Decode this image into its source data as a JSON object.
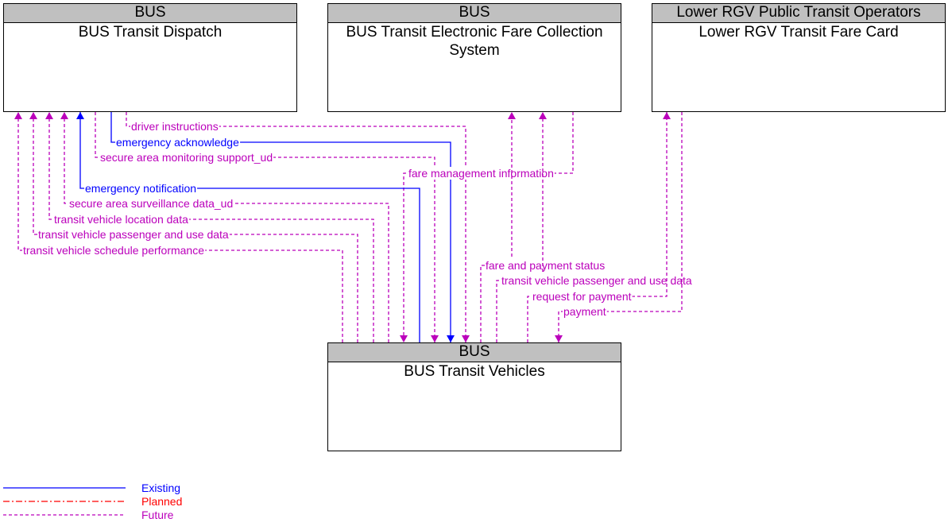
{
  "colors": {
    "existing": "#0000ff",
    "planned": "#ff0000",
    "future": "#bb00bb",
    "header_bg": "#c0c0c0"
  },
  "nodes": [
    {
      "id": "dispatch",
      "owner": "BUS",
      "name": "BUS Transit Dispatch"
    },
    {
      "id": "efc",
      "owner": "BUS",
      "name": "BUS Transit Electronic Fare Collection System"
    },
    {
      "id": "farecard",
      "owner": "Lower RGV Public Transit Operators",
      "name": "Lower RGV Transit Fare Card"
    },
    {
      "id": "vehicles",
      "owner": "BUS",
      "name": "BUS Transit Vehicles"
    }
  ],
  "flows": [
    {
      "label": "driver instructions",
      "from": "dispatch",
      "to": "vehicles",
      "status": "future"
    },
    {
      "label": "emergency acknowledge",
      "from": "dispatch",
      "to": "vehicles",
      "status": "existing"
    },
    {
      "label": "secure area monitoring support_ud",
      "from": "dispatch",
      "to": "vehicles",
      "status": "future"
    },
    {
      "label": "fare management information",
      "from": "efc",
      "to": "vehicles",
      "status": "future"
    },
    {
      "label": "emergency notification",
      "from": "vehicles",
      "to": "dispatch",
      "status": "existing"
    },
    {
      "label": "secure area surveillance data_ud",
      "from": "vehicles",
      "to": "dispatch",
      "status": "future"
    },
    {
      "label": "transit vehicle location data",
      "from": "vehicles",
      "to": "dispatch",
      "status": "future"
    },
    {
      "label": "transit vehicle passenger and use data",
      "from": "vehicles",
      "to": "dispatch",
      "status": "future"
    },
    {
      "label": "transit vehicle schedule performance",
      "from": "vehicles",
      "to": "dispatch",
      "status": "future"
    },
    {
      "label": "fare and payment status",
      "from": "vehicles",
      "to": "efc",
      "status": "future"
    },
    {
      "label": "transit vehicle passenger and use data",
      "from": "vehicles",
      "to": "efc",
      "status": "future"
    },
    {
      "label": "request for payment",
      "from": "vehicles",
      "to": "farecard",
      "status": "future"
    },
    {
      "label": "payment",
      "from": "farecard",
      "to": "vehicles",
      "status": "future"
    }
  ],
  "legend": [
    {
      "label": "Existing",
      "status": "existing"
    },
    {
      "label": "Planned",
      "status": "planned"
    },
    {
      "label": "Future",
      "status": "future"
    }
  ]
}
